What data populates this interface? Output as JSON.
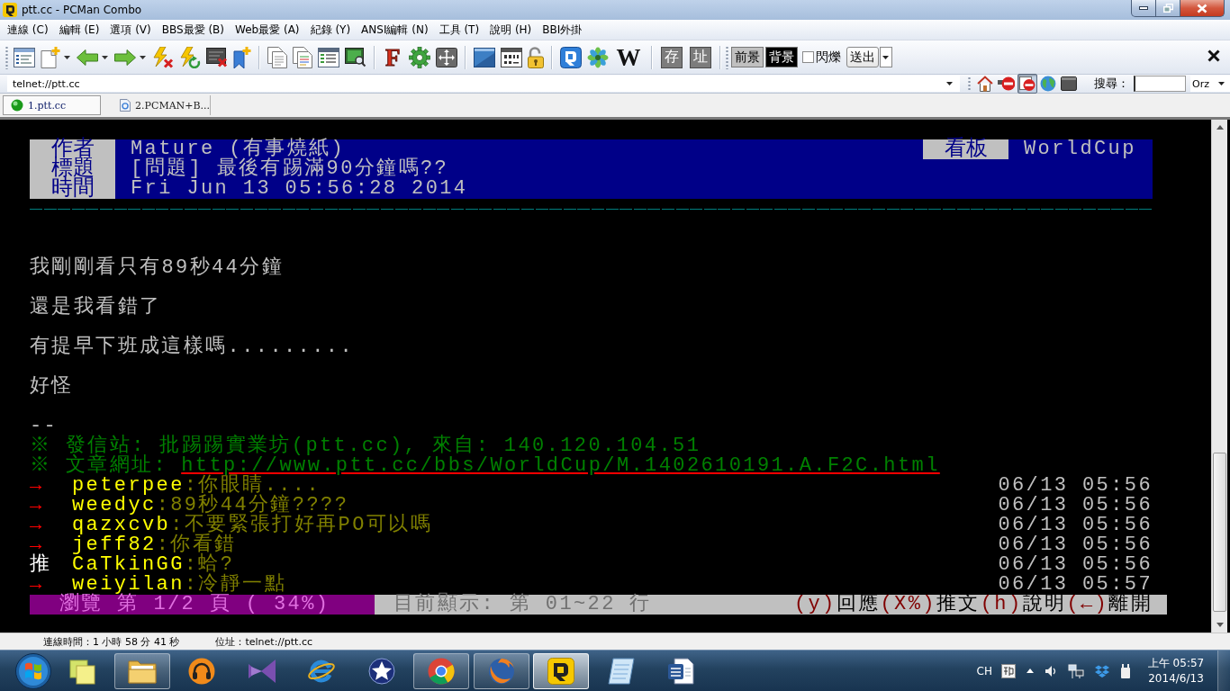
{
  "window": {
    "title": "ptt.cc - PCMan Combo"
  },
  "menu_bar": [
    "連線 (C)",
    "編輯 (E)",
    "選項 (V)",
    "BBS最愛 (B)",
    "Web最愛 (A)",
    "紀錄 (Y)",
    "ANSI編輯 (N)",
    "工具 (T)",
    "說明 (H)",
    "BBI外掛"
  ],
  "toolbar": {
    "letter_buttons": [
      "F",
      "W"
    ],
    "text_buttons": [
      "存",
      "址"
    ],
    "color_buttons": [
      {
        "label": "前景",
        "color": "#c0c0c0"
      },
      {
        "label": "背景",
        "color": "#000000"
      }
    ],
    "blink": {
      "label": "閃爍",
      "checked": false
    },
    "send_button": "送出"
  },
  "address_bar": {
    "address": "telnet://ptt.cc",
    "tools": [
      {
        "on": false
      },
      {
        "on": false
      },
      {
        "on": true
      },
      {
        "on": false
      },
      {
        "on": false
      }
    ],
    "search_label": "搜尋：",
    "search_engine": "Orz"
  },
  "tabs": [
    {
      "label": "1.ptt.cc",
      "kind": "connection",
      "selected": true
    },
    {
      "label": "2.PCMAN+B...",
      "kind": "document",
      "selected": false
    }
  ],
  "terminal": {
    "header": {
      "fields": [
        {
          "label": "作者",
          "value": "Mature (有事燒紙)"
        },
        {
          "label": "標題",
          "value": "[問題] 最後有踢滿90分鐘嗎??"
        },
        {
          "label": "時間",
          "value": "Fri Jun 13 05:56:28 2014"
        }
      ],
      "board": {
        "label": "看板",
        "value": "WorldCup"
      }
    },
    "body": [
      "我剛剛看只有89秒44分鐘",
      "還是我看錯了",
      "有提早下班成這樣嗎.........",
      "好怪"
    ],
    "signature": {
      "divider": "--",
      "origin": "※ 發信站: 批踢踢實業坊(ptt.cc), 來自: 140.120.104.51",
      "url_label": "※ 文章網址:",
      "url": "http://www.ptt.cc/bbs/WorldCup/M.1402610191.A.F2C.html"
    },
    "comments": [
      {
        "kind": "arrow",
        "tag": "→",
        "user": "peterpee",
        "text": ":你眼睛....",
        "time": "06/13 05:56"
      },
      {
        "kind": "arrow",
        "tag": "→",
        "user": "weedyc",
        "text": ":89秒44分鐘????",
        "time": "06/13 05:56"
      },
      {
        "kind": "arrow",
        "tag": "→",
        "user": "qazxcvb",
        "text": ":不要緊張打好再PO可以嗎",
        "time": "06/13 05:56"
      },
      {
        "kind": "arrow",
        "tag": "→",
        "user": "jeff82",
        "text": ":你看錯",
        "time": "06/13 05:56"
      },
      {
        "kind": "push",
        "tag": "推",
        "user": "CaTkinGG",
        "text": ":蛤?",
        "time": "06/13 05:56"
      },
      {
        "kind": "arrow",
        "tag": "→",
        "user": "weiyilan",
        "text": ":冷靜一點",
        "time": "06/13 05:57"
      }
    ],
    "status_line": {
      "position": "瀏覽 第 1/2 頁 ( 34%)",
      "info": "目前顯示: 第 01~22 行",
      "keys": [
        {
          "key": "(y)",
          "action": "回應"
        },
        {
          "key": "(X%)",
          "action": "推文"
        },
        {
          "key": "(h)",
          "action": "說明"
        },
        {
          "key": "(←)",
          "action": "離開"
        }
      ]
    }
  },
  "status_bar": {
    "connection_time": "連線時間：1 小時 58 分 41 秒",
    "address": "位址：telnet://ptt.cc"
  },
  "taskbar": {
    "apps": [
      {
        "running": false,
        "selected": false
      },
      {
        "running": true,
        "selected": false
      },
      {
        "running": false,
        "selected": false
      },
      {
        "running": false,
        "selected": false
      },
      {
        "running": false,
        "selected": false
      },
      {
        "running": false,
        "selected": false
      },
      {
        "running": true,
        "selected": false
      },
      {
        "running": true,
        "selected": false
      },
      {
        "running": true,
        "selected": true
      },
      {
        "running": false,
        "selected": false
      },
      {
        "running": false,
        "selected": false
      }
    ],
    "language": "CH",
    "clock": {
      "time": "上午 05:57",
      "date": "2014/6/13"
    }
  }
}
